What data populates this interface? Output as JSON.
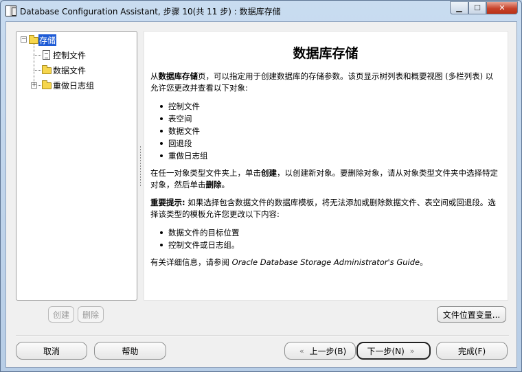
{
  "window": {
    "title": "Database Configuration Assistant, 步骤 10(共 11 步) : 数据库存储"
  },
  "tree": {
    "root_label": "存储",
    "items": [
      {
        "label": "控制文件",
        "icon": "file-icon"
      },
      {
        "label": "数据文件",
        "icon": "folder-icon"
      },
      {
        "label": "重做日志组",
        "icon": "folder-icon"
      }
    ]
  },
  "tree_buttons": {
    "create": "创建",
    "delete": "删除"
  },
  "content": {
    "title": "数据库存储",
    "intro_prefix": "从",
    "intro_bold": "数据库存储",
    "intro_rest": "页，可以指定用于创建数据库的存储参数。该页显示树列表和概要视图 (多栏列表) 以允许您更改并查看以下对象:",
    "objects": [
      "控制文件",
      "表空间",
      "数据文件",
      "回退段",
      "重做日志组"
    ],
    "create_text_1": "在任一对象类型文件夹上，单击",
    "create_bold": "创建",
    "create_text_2": "，以创建新对象。要删除对象，请从对象类型文件夹中选择特定对象，然后单击",
    "delete_bold": "删除",
    "create_text_3": "。",
    "important_bold": "重要提示:",
    "important_text": " 如果选择包含数据文件的数据库模板，将无法添加或删除数据文件、表空间或回退段。选择该类型的模板允许您更改以下内容:",
    "changes": [
      "数据文件的目标位置",
      "控制文件或日志组。"
    ],
    "guide_prefix": "有关详细信息，请参阅 ",
    "guide_title": "Oracle Database Storage Administrator's Guide",
    "guide_suffix": "。"
  },
  "buttons": {
    "file_location": "文件位置变量...",
    "cancel": "取消",
    "help": "帮助",
    "back": "上一步(B)",
    "next": "下一步(N)",
    "finish": "完成(F)"
  }
}
